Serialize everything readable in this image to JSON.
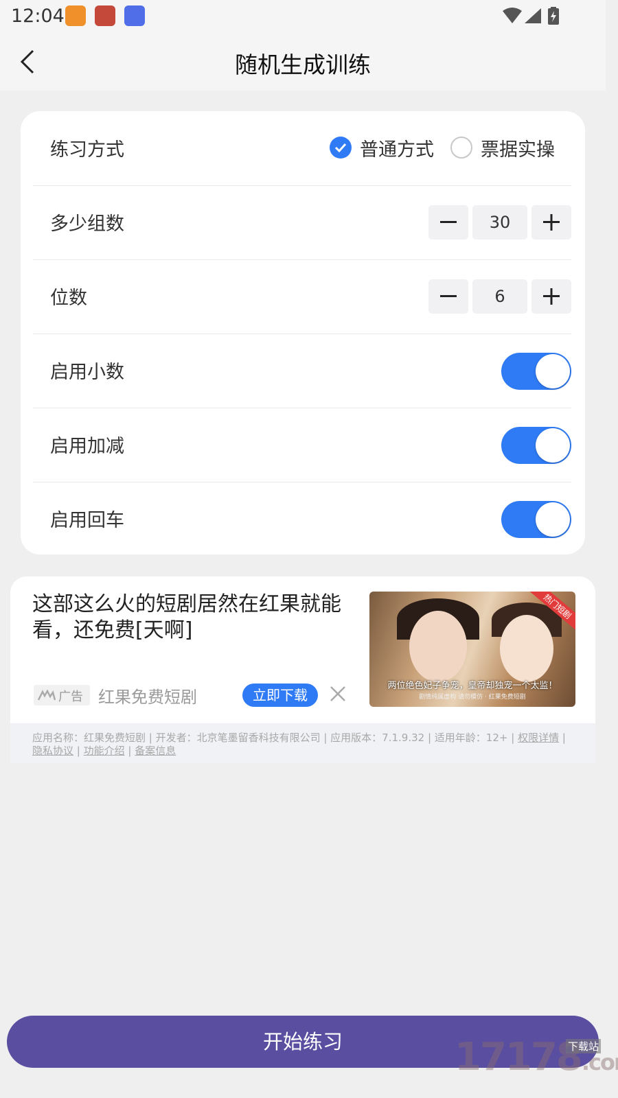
{
  "status_bar": {
    "time": "12:04",
    "app_icons": [
      "orange-app-icon",
      "red-app-icon",
      "blue-app-icon"
    ],
    "system_icons": [
      "wifi-icon",
      "signal-icon",
      "battery-charging-icon"
    ]
  },
  "header": {
    "title": "随机生成训练",
    "back_icon": "chevron-left-icon"
  },
  "settings": {
    "mode": {
      "label": "练习方式",
      "options": [
        {
          "label": "普通方式",
          "selected": true
        },
        {
          "label": "票据实操",
          "selected": false
        }
      ]
    },
    "groups": {
      "label": "多少组数",
      "value": "30"
    },
    "digits": {
      "label": "位数",
      "value": "6"
    },
    "decimal": {
      "label": "启用小数",
      "on": true
    },
    "add_sub": {
      "label": "启用加减",
      "on": true
    },
    "enter": {
      "label": "启用回车",
      "on": true
    }
  },
  "ad": {
    "headline": "这部这么火的短剧居然在红果就能看，还免费[天啊]",
    "tag": "广告",
    "app_name": "红果免费短剧",
    "cta": "立即下载",
    "image_badge": "热门短剧",
    "image_caption": "两位绝色妃子争宠，皇帝却独宠一个太监！",
    "image_subcaption": "剧情纯属虚构 请勿模仿 · 红果免费短剧",
    "footer_line1": "应用名称：红果免费短剧 | 开发者：北京笔墨留香科技有限公司 | 应用版本：7.1.9.32 | 适用年龄：12+ |",
    "footer_link1": "权限详情",
    "footer_link2": "隐私协议",
    "footer_link3": "功能介绍",
    "footer_link4": "备案信息"
  },
  "actions": {
    "start": "开始练习"
  },
  "watermark": {
    "text": "17178",
    "sub": "下载站",
    "suffix": ".com"
  },
  "colors": {
    "accent": "#2f7bf5",
    "start_button": "#5a4ea0",
    "background": "#efefef"
  }
}
